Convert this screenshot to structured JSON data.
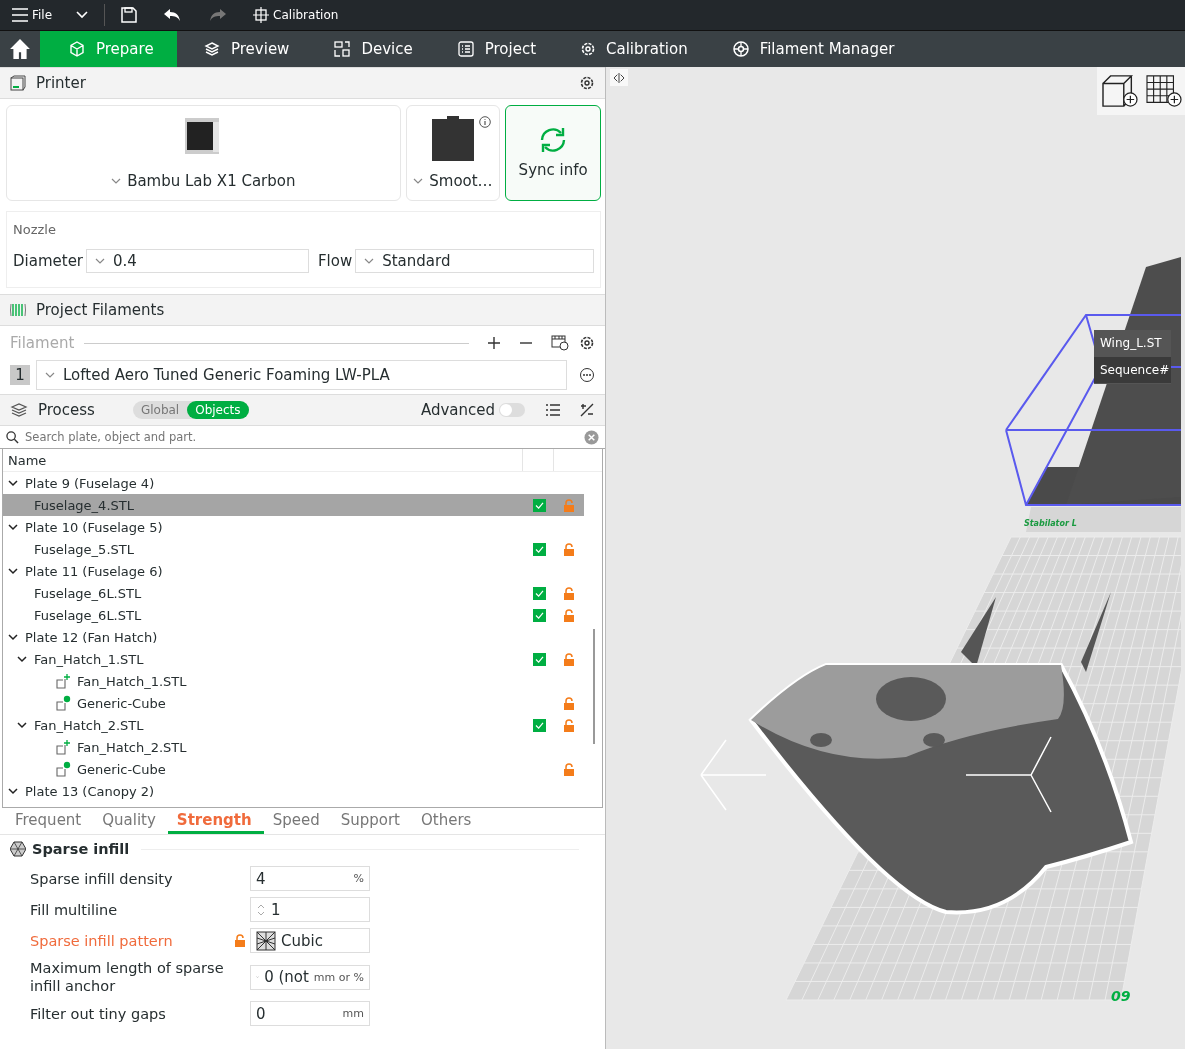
{
  "toolbar": {
    "file_label": "File",
    "title": "Calibration"
  },
  "nav": [
    {
      "label": "Prepare",
      "selected": true
    },
    {
      "label": "Preview",
      "selected": false
    },
    {
      "label": "Device",
      "selected": false
    },
    {
      "label": "Project",
      "selected": false
    },
    {
      "label": "Calibration",
      "selected": false
    },
    {
      "label": "Filament Manager",
      "selected": false
    }
  ],
  "printer": {
    "title": "Printer",
    "model": "Bambu Lab X1 Carbon",
    "plate": "Smoot…",
    "sync": "Sync info",
    "nozzle_title": "Nozzle",
    "diameter_label": "Diameter",
    "diameter": "0.4",
    "flow_label": "Flow",
    "flow": "Standard"
  },
  "filaments": {
    "title": "Project Filaments",
    "label": "Filament",
    "items": [
      {
        "index": "1",
        "name": "Lofted Aero Tuned Generic Foaming LW-PLA"
      }
    ]
  },
  "process": {
    "title": "Process",
    "modes": [
      {
        "label": "Global",
        "selected": false
      },
      {
        "label": "Objects",
        "selected": true
      }
    ],
    "advanced_label": "Advanced",
    "advanced": false
  },
  "objects": {
    "search_placeholder": "Search plate, object and part.",
    "name_column": "Name",
    "items": [
      {
        "kind": "plate",
        "label": "Plate 9 (Fuselage 4)",
        "expanded": true,
        "selected": false,
        "children": [
          {
            "kind": "object",
            "label": "Fuselage_4.STL",
            "checked": true,
            "selected": true
          }
        ]
      },
      {
        "kind": "plate",
        "label": "Plate 10 (Fuselage 5)",
        "expanded": true,
        "selected": false,
        "children": [
          {
            "kind": "object",
            "label": "Fuselage_5.STL",
            "checked": true,
            "selected": false
          }
        ]
      },
      {
        "kind": "plate",
        "label": "Plate 11 (Fuselage 6)",
        "expanded": true,
        "selected": false,
        "children": [
          {
            "kind": "object",
            "label": "Fuselage_6L.STL",
            "checked": true,
            "selected": false
          },
          {
            "kind": "object",
            "label": "Fuselage_6L.STL",
            "checked": true,
            "selected": false
          }
        ]
      },
      {
        "kind": "plate",
        "label": "Plate 12 (Fan Hatch)",
        "expanded": true,
        "selected": false,
        "children": [
          {
            "kind": "object",
            "label": "Fan_Hatch_1.STL",
            "checked": true,
            "selected": false,
            "expanded": true,
            "children": [
              {
                "kind": "part",
                "label": "Fan_Hatch_1.STL",
                "selected": false
              },
              {
                "kind": "modifier",
                "label": "Generic-Cube",
                "selected": false
              }
            ]
          },
          {
            "kind": "object",
            "label": "Fan_Hatch_2.STL",
            "checked": true,
            "selected": false,
            "expanded": true,
            "children": [
              {
                "kind": "part",
                "label": "Fan_Hatch_2.STL",
                "selected": false
              },
              {
                "kind": "modifier",
                "label": "Generic-Cube",
                "selected": false
              }
            ]
          }
        ]
      },
      {
        "kind": "plate",
        "label": "Plate 13 (Canopy 2)",
        "expanded": true,
        "selected": false
      }
    ]
  },
  "settings_tabs": [
    {
      "label": "Frequent",
      "selected": false
    },
    {
      "label": "Quality",
      "selected": false
    },
    {
      "label": "Strength",
      "selected": true
    },
    {
      "label": "Speed",
      "selected": false
    },
    {
      "label": "Support",
      "selected": false
    },
    {
      "label": "Others",
      "selected": false
    }
  ],
  "sparse_infill": {
    "title": "Sparse infill",
    "rows": [
      {
        "kind": "text",
        "label": "Sparse infill density",
        "value": "4",
        "unit": "%",
        "modified": false
      },
      {
        "kind": "spin",
        "label": "Fill multiline",
        "value": "1",
        "modified": false
      },
      {
        "kind": "pattern",
        "label": "Sparse infill pattern",
        "value": "Cubic",
        "modified": true
      },
      {
        "kind": "combo",
        "label": "Maximum length of sparse infill anchor",
        "value": "0 (not",
        "unit": "mm or %",
        "modified": false
      },
      {
        "kind": "text",
        "label": "Filter out tiny gaps",
        "value": "0",
        "unit": "mm",
        "modified": false
      }
    ]
  },
  "viewport": {
    "tooltip": [
      "Wing_L.ST",
      "Sequence#"
    ],
    "bed_label": "Stabilator L",
    "plate_number": "09"
  }
}
